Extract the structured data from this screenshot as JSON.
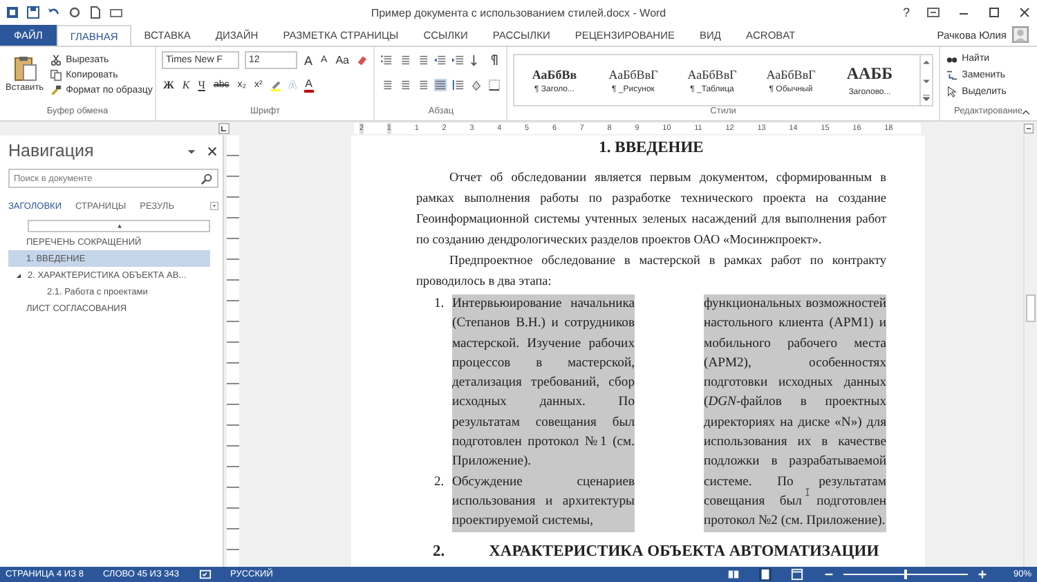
{
  "window": {
    "title": "Пример документа с использованием стилей.docx - Word",
    "help": "?",
    "user": "Рачкова Юлия"
  },
  "ribbon_tabs": [
    {
      "label": "ФАЙЛ",
      "kind": "file",
      "selected": false
    },
    {
      "label": "ГЛАВНАЯ",
      "kind": "tab",
      "selected": true
    },
    {
      "label": "ВСТАВКА",
      "kind": "tab",
      "selected": false
    },
    {
      "label": "ДИЗАЙН",
      "kind": "tab",
      "selected": false
    },
    {
      "label": "РАЗМЕТКА СТРАНИЦЫ",
      "kind": "tab",
      "selected": false
    },
    {
      "label": "ССЫЛКИ",
      "kind": "tab",
      "selected": false
    },
    {
      "label": "РАССЫЛКИ",
      "kind": "tab",
      "selected": false
    },
    {
      "label": "РЕЦЕНЗИРОВАНИЕ",
      "kind": "tab",
      "selected": false
    },
    {
      "label": "ВИД",
      "kind": "tab",
      "selected": false
    },
    {
      "label": "ACROBAT",
      "kind": "tab",
      "selected": false
    }
  ],
  "clipboard": {
    "paste": "Вставить",
    "items": [
      "Вырезать",
      "Копировать",
      "Формат по образцу"
    ],
    "label": "Буфер обмена"
  },
  "font": {
    "name": "Times New F",
    "size": "12",
    "label": "Шрифт",
    "row1_buttons": [
      {
        "label": "A",
        "kind": "grow"
      },
      {
        "label": "A",
        "kind": "shrink"
      },
      {
        "label": "Aa",
        "kind": "case"
      }
    ],
    "row2_buttons": [
      {
        "label": "Ж",
        "kind": "bold"
      },
      {
        "label": "К",
        "kind": "italic"
      },
      {
        "label": "Ч",
        "kind": "underline"
      },
      {
        "label": "abc",
        "kind": "strike"
      },
      {
        "label": "x₂",
        "kind": "sub"
      },
      {
        "label": "x²",
        "kind": "sup"
      },
      {
        "label": "A",
        "kind": "effects"
      },
      {
        "label": "A",
        "kind": "color"
      }
    ]
  },
  "paragraph": {
    "label": "Абзац",
    "align_buttons": [
      {
        "kind": "left",
        "selected": false
      },
      {
        "kind": "center",
        "selected": false
      },
      {
        "kind": "right",
        "selected": false
      },
      {
        "kind": "justify",
        "selected": true
      }
    ]
  },
  "styles": {
    "label": "Стили",
    "items": [
      {
        "preview": "АаБбВв",
        "name": "¶ Заголо...",
        "kind": "heading"
      },
      {
        "preview": "АаБбВвГ",
        "name": "¶ _Рисунок",
        "kind": "normal"
      },
      {
        "preview": "АаБбВвГ",
        "name": "¶ _Таблица",
        "kind": "normal"
      },
      {
        "preview": "АаБбВвГ",
        "name": "¶ Обычный",
        "kind": "normal"
      },
      {
        "preview": "ААББ",
        "name": "Заголово...",
        "kind": "title"
      }
    ]
  },
  "editing": {
    "label": "Редактирование",
    "items": [
      "Найти",
      "Заменить",
      "Выделить"
    ]
  },
  "ruler": {
    "labels": [
      "2",
      "1",
      "1",
      "2",
      "3",
      "4",
      "5",
      "6",
      "7",
      "8",
      "9",
      "10",
      "11",
      "12",
      "13",
      "14",
      "15",
      "16",
      "18"
    ]
  },
  "navigation": {
    "title": "Навигация",
    "search": {
      "placeholder": "Поиск в документе"
    },
    "tabs": [
      {
        "label": "ЗАГОЛОВКИ",
        "selected": true
      },
      {
        "label": "СТРАНИЦЫ",
        "selected": false
      },
      {
        "label": "РЕЗУЛЬ",
        "selected": false
      }
    ],
    "headings": [
      {
        "label": "ПЕРЕЧЕНЬ СОКРАЩЕНИЙ",
        "selected": false
      },
      {
        "label": "1. ВВЕДЕНИЕ",
        "selected": true
      },
      {
        "label": "2. ХАРАКТЕРИСТИКА ОБЪЕКТА АВ...",
        "selected": false,
        "expanded": true,
        "children": [
          {
            "label": "2.1. Работа с проектами",
            "selected": false
          }
        ]
      },
      {
        "label": "ЛИСТ СОГЛАСОВАНИЯ",
        "selected": false
      }
    ]
  },
  "document": {
    "heading": "1. ВВЕДЕНИЕ",
    "paragraphs": [
      "Отчет об обследовании является первым документом, сформированным в рамках выполнения работы по разработке технического проекта на создание Геоинформационной системы учтенных зеленых насаждений для выполнения работ по созданию дендрологических разделов проектов ОАО «Мосинжпроект».",
      "Предпроектное обследование в мастерской в рамках работ по контракту проводилось в два этапа:"
    ],
    "list": {
      "selected": true,
      "items": [
        {
          "number": "1.",
          "text": "Интервьюирование начальника (Степанов В.Н.) и сотрудников мастерской. Изучение рабочих процессов в мастерской, детализация требований, сбор исходных данных. По результатам совещания был подготовлен протокол №1 (см. Приложение)."
        },
        {
          "number": "2.",
          "text": "Обсуждение сценариев использования и архитектуры проектируемой системы,"
        }
      ],
      "continuation": "функциональных возможностей настольного клиента (АРМ1) и мобильного рабочего места (АРМ2), особенностях подготовки исходных данных (*DGN*-файлов в проектных директориях на диске «N») для использования их в качестве подложки в разрабатываемой системе. По результатам совещания был подготовлен протокол №2 (см. Приложение)."
    },
    "next_heading": {
      "number": "2.",
      "text": "ХАРАКТЕРИСТИКА ОБЪЕКТА АВТОМАТИЗАЦИИ"
    }
  },
  "status_bar": {
    "page": "СТРАНИЦА 4 ИЗ 8",
    "words": "СЛОВО 45 ИЗ 343",
    "language": "РУССКИЙ",
    "zoom": {
      "level": 0.5,
      "reading": "90%"
    }
  }
}
